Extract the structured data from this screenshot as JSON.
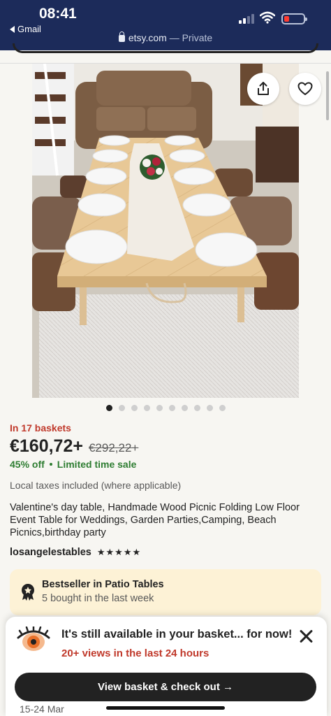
{
  "status_bar": {
    "time": "08:41",
    "back_app": "Gmail",
    "domain": "etsy.com",
    "mode": "— Private"
  },
  "product": {
    "image_alt": "Wooden low floor table set with white plates and flowers",
    "buttons": {
      "share_icon": "share-icon",
      "favorite_icon": "heart-icon"
    },
    "image_count": 10,
    "active_image_index": 0,
    "baskets": "In 17 baskets",
    "price": "€160,72+",
    "old_price": "€292,22+",
    "discount": "45% off",
    "sale_label": "Limited time sale",
    "taxes": "Local taxes included (where applicable)",
    "title": "Valentine's day table, Handmade Wood Picnic Folding Low Floor Event Table for Weddings, Garden Parties,Camping, Beach Picnics,birthday party",
    "shop": "losangelestables",
    "rating_stars": "★★★★★"
  },
  "bestseller": {
    "title": "Bestseller in Patio Tables",
    "subtitle": "5 bought in the last week"
  },
  "basket_prompt": {
    "title": "It's still available in your basket... for now!",
    "views": "20+ views in the last 24 hours",
    "button": "View basket & check out →",
    "peek_text": "15-24 Mar"
  },
  "colors": {
    "header_bg": "#1c2b5a",
    "alert_red": "#c0392b",
    "sale_green": "#2e7d32",
    "bestseller_bg": "#fdf2d6",
    "button_dark": "#222222"
  }
}
